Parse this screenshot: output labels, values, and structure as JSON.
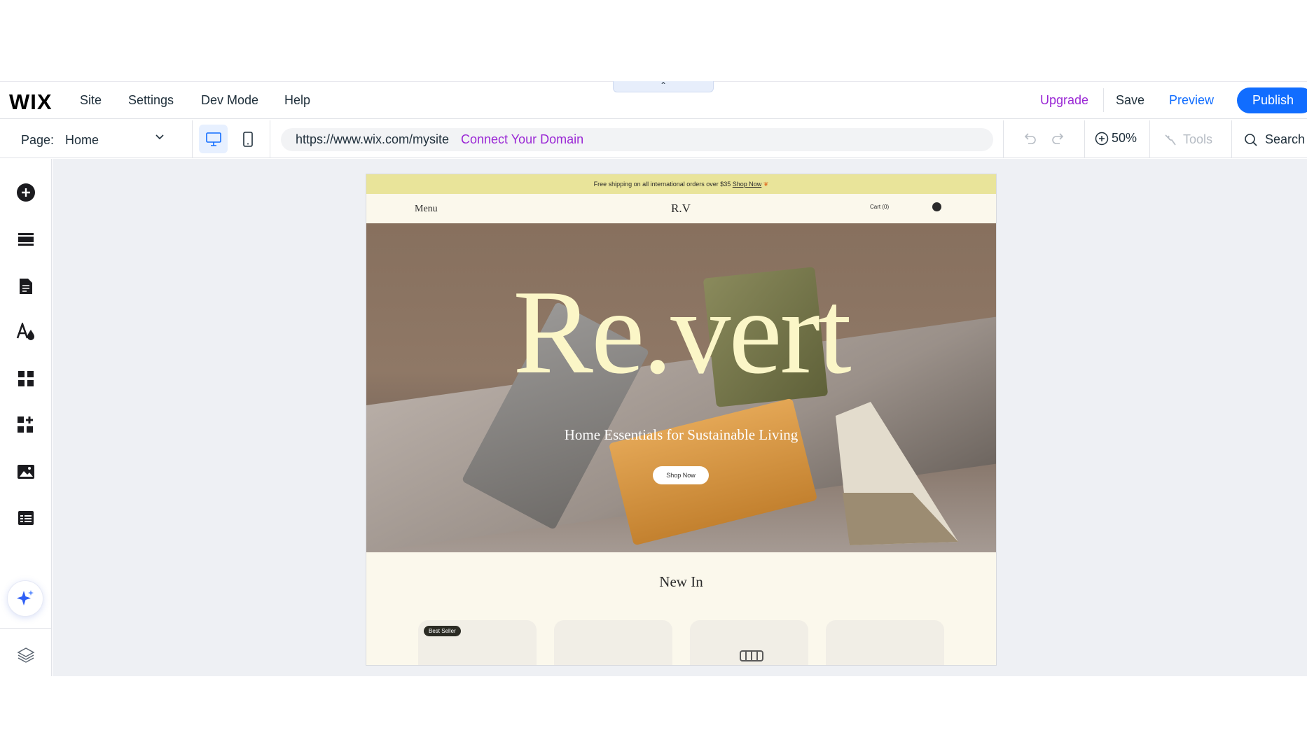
{
  "topbar": {
    "logo": "WIX",
    "menu": [
      "Site",
      "Settings",
      "Dev Mode",
      "Help"
    ],
    "upgrade": "Upgrade",
    "save": "Save",
    "preview": "Preview",
    "publish": "Publish",
    "collapse_icon": "chevron-up-icon",
    "colors": {
      "upgrade": "#9a27d5",
      "preview": "#116dff",
      "publish_bg": "#116dff"
    }
  },
  "toolbar": {
    "page_label": "Page:",
    "page_value": "Home",
    "url": "https://www.wix.com/mysite",
    "connect_domain": "Connect Your Domain",
    "zoom": "50%",
    "tools": "Tools",
    "search": "Search"
  },
  "sidebar": {
    "icons": [
      "add-elements-icon",
      "sections-icon",
      "pages-icon",
      "design-icon",
      "apps-icon",
      "add-apps-icon",
      "media-icon",
      "cms-icon",
      "ai-assistant-icon",
      "layers-icon"
    ]
  },
  "site": {
    "banner_text": "Free shipping on all international orders over $35",
    "banner_link": "Shop Now",
    "menu": "Menu",
    "logo": "R.V",
    "cart": "Cart (0)",
    "hero_title": "Re.vert",
    "hero_subtitle": "Home Essentials for Sustainable Living",
    "hero_button": "Shop Now",
    "section_title": "New In",
    "badge": "Best Seller"
  }
}
